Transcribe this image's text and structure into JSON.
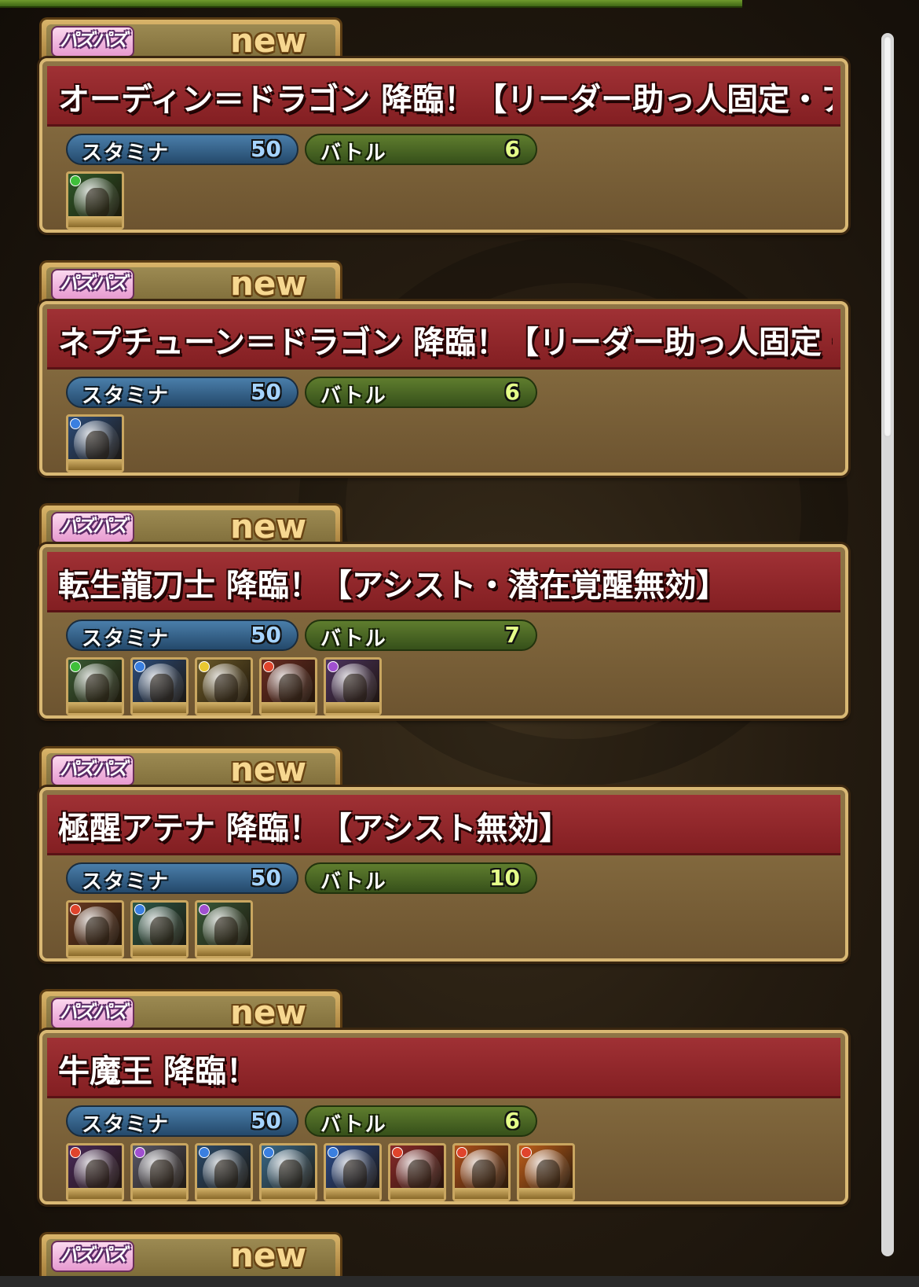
{
  "dungeons": [
    {
      "logo": "パズパズ",
      "badge": "new",
      "title": "オーディン＝ドラゴン 降臨！【リーダー助っ人固定・アシスト無効】",
      "stamina_label": "スタミナ",
      "stamina": "50",
      "battle_label": "バトル",
      "battles": "6",
      "monsters": [
        {
          "name": "green-dragon-knight-icon",
          "attr_color": "#3fbf3a",
          "bg": "#2f5a2a"
        }
      ]
    },
    {
      "logo": "パズパズ",
      "badge": "new",
      "title": "ネプチューン＝ドラゴン 降臨！【リーダー助っ人固定・アシスト無効】",
      "stamina_label": "スタミナ",
      "stamina": "50",
      "battle_label": "バトル",
      "battles": "6",
      "monsters": [
        {
          "name": "blue-dragon-icon",
          "attr_color": "#3a7fe0",
          "bg": "#2c4c7a"
        }
      ]
    },
    {
      "logo": "パズパズ",
      "badge": "new",
      "title": "転生龍刀士 降臨！【アシスト・潜在覚醒無効】",
      "stamina_label": "スタミナ",
      "stamina": "50",
      "battle_label": "バトル",
      "battles": "7",
      "monsters": [
        {
          "name": "green-swordswoman-icon",
          "attr_color": "#3fbf3a",
          "bg": "#3a5a34"
        },
        {
          "name": "blue-swordsman-icon",
          "attr_color": "#3a7fe0",
          "bg": "#2c4c7a"
        },
        {
          "name": "light-swordsman-icon",
          "attr_color": "#e8c830",
          "bg": "#6b5a2a"
        },
        {
          "name": "red-swordsman-icon",
          "attr_color": "#e0442c",
          "bg": "#6a2c22"
        },
        {
          "name": "dark-swordswoman-icon",
          "attr_color": "#a050d0",
          "bg": "#4c3460"
        }
      ]
    },
    {
      "logo": "パズパズ",
      "badge": "new",
      "title": "極醒アテナ 降臨！【アシスト無効】",
      "stamina_label": "スタミナ",
      "stamina": "50",
      "battle_label": "バトル",
      "battles": "10",
      "monsters": [
        {
          "name": "red-athena-icon",
          "attr_color": "#e0442c",
          "bg": "#6a3a22"
        },
        {
          "name": "blue-athena-icon",
          "attr_color": "#3a7fe0",
          "bg": "#2c5a4a"
        },
        {
          "name": "dark-athena-icon",
          "attr_color": "#a050d0",
          "bg": "#3a5a3a"
        }
      ]
    },
    {
      "logo": "パズパズ",
      "badge": "new",
      "title": "牛魔王 降臨！",
      "stamina_label": "スタミナ",
      "stamina": "50",
      "battle_label": "バトル",
      "battles": "6",
      "monsters": [
        {
          "name": "red-demon-bull-icon",
          "attr_color": "#e0442c",
          "bg": "#4a2a5a"
        },
        {
          "name": "dark-knight-icon",
          "attr_color": "#a050d0",
          "bg": "#5a5a6a"
        },
        {
          "name": "blue-dragon-warrior-icon",
          "attr_color": "#3a7fe0",
          "bg": "#2a4a6a"
        },
        {
          "name": "blue-evo-egg-icon",
          "attr_color": "#3a7fe0",
          "bg": "#3a6a8a"
        },
        {
          "name": "blue-evo-egg-icon",
          "attr_color": "#3a7fe0",
          "bg": "#2a4a8a"
        },
        {
          "name": "red-girl-icon",
          "attr_color": "#e0442c",
          "bg": "#8a2a2a"
        },
        {
          "name": "red-evo-egg-icon",
          "attr_color": "#e0442c",
          "bg": "#b0521c"
        },
        {
          "name": "red-evo-egg-icon",
          "attr_color": "#e0442c",
          "bg": "#c0601c"
        }
      ]
    },
    {
      "logo": "パズパズ",
      "badge": "new"
    }
  ]
}
